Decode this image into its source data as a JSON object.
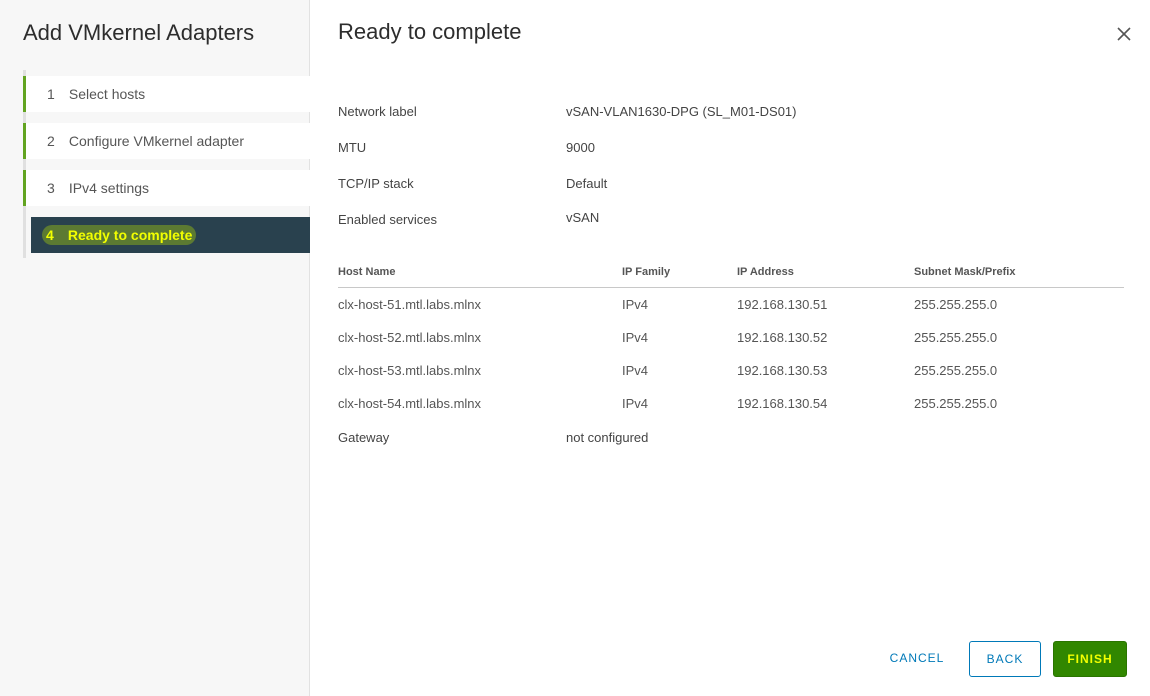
{
  "wizard": {
    "title": "Add VMkernel Adapters",
    "steps": [
      {
        "num": "1",
        "label": "Select hosts"
      },
      {
        "num": "2",
        "label": "Configure VMkernel adapter"
      },
      {
        "num": "3",
        "label": "IPv4 settings"
      },
      {
        "num": "4",
        "label": "Ready to complete"
      }
    ]
  },
  "main": {
    "title": "Ready to complete",
    "summary": [
      {
        "key": "Network label",
        "value": "vSAN-VLAN1630-DPG (SL_M01-DS01)"
      },
      {
        "key": "MTU",
        "value": "9000"
      },
      {
        "key": "TCP/IP stack",
        "value": "Default"
      },
      {
        "key": "Enabled services",
        "value": "vSAN"
      }
    ],
    "table": {
      "columns": [
        "Host Name",
        "IP Family",
        "IP Address",
        "Subnet Mask/Prefix"
      ],
      "rows": [
        [
          "clx-host-51.mtl.labs.mlnx",
          "IPv4",
          "192.168.130.51",
          "255.255.255.0"
        ],
        [
          "clx-host-52.mtl.labs.mlnx",
          "IPv4",
          "192.168.130.52",
          "255.255.255.0"
        ],
        [
          "clx-host-53.mtl.labs.mlnx",
          "IPv4",
          "192.168.130.53",
          "255.255.255.0"
        ],
        [
          "clx-host-54.mtl.labs.mlnx",
          "IPv4",
          "192.168.130.54",
          "255.255.255.0"
        ]
      ]
    },
    "gateway": {
      "key": "Gateway",
      "value": "not configured"
    }
  },
  "footer": {
    "cancel": "CANCEL",
    "back": "BACK",
    "finish": "FINISH"
  },
  "icons": {
    "close": "close-icon"
  },
  "colors": {
    "accent": "#62a420",
    "active_bg": "#29414e",
    "highlight": "#f2ff00",
    "finish_bg": "#318700",
    "link": "#0079b8"
  }
}
